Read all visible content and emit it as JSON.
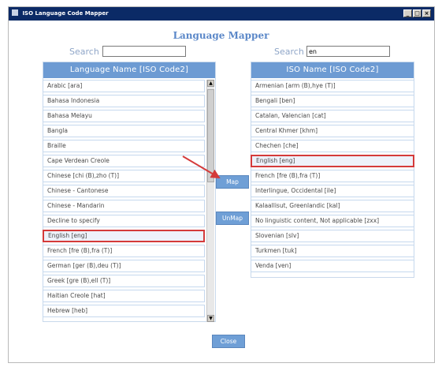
{
  "window": {
    "title": "ISO Language Code Mapper",
    "controls": [
      "_",
      "□",
      "×"
    ]
  },
  "heading": "Language Mapper",
  "left": {
    "search_label": "Search",
    "search_value": "",
    "header": "Language Name [ISO Code2]",
    "items": [
      "Arabic [ara]",
      "Bahasa Indonesia",
      "Bahasa Melayu",
      "Bangla",
      "Braille",
      "Cape Verdean Creole",
      "Chinese [chi (B),zho (T)]",
      "Chinese - Cantonese",
      "Chinese - Mandarin",
      "Decline to specify",
      "English [eng]",
      "French [fre (B),fra (T)]",
      "German [ger (B),deu (T)]",
      "Greek [gre (B),ell (T)]",
      "Haitian Creole [hat]",
      "Hebrew [heb]"
    ],
    "selected_index": 10
  },
  "right": {
    "search_label": "Search",
    "search_value": "en",
    "header": "ISO Name [ISO Code2]",
    "items": [
      "Armenian [arm (B),hye (T)]",
      "Bengali [ben]",
      "Catalan, Valencian [cat]",
      "Central Khmer [khm]",
      "Chechen [che]",
      "English [eng]",
      "French [fre (B),fra (T)]",
      "Interlingue, Occidental [ile]",
      "Kalaallisut, Greenlandic [kal]",
      "No linguistic content, Not applicable [zxx]",
      "Slovenian [slv]",
      "Turkmen [tuk]",
      "Venda [ven]"
    ],
    "selected_index": 5
  },
  "buttons": {
    "map": "Map",
    "unmap": "UnMap",
    "close": "Close"
  },
  "colors": {
    "accent": "#6d9bd3",
    "highlight": "#d43a3a",
    "titlebar": "#0b2a66"
  }
}
